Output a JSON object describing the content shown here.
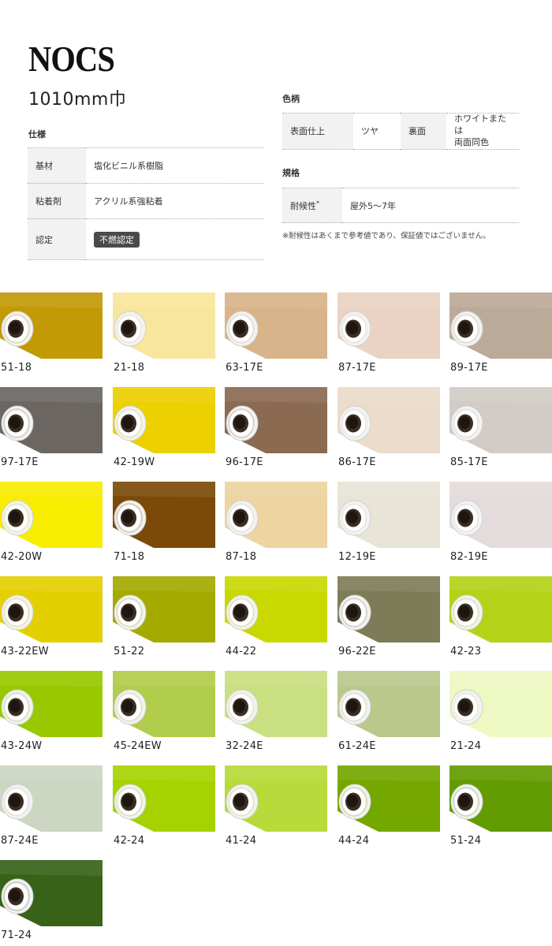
{
  "header": {
    "brand": "NOCS",
    "width": "1010mm巾"
  },
  "spec": {
    "title": "仕様",
    "rows": [
      {
        "key": "基材",
        "value": "塩化ビニル系樹脂"
      },
      {
        "key": "粘着剤",
        "value": "アクリル系強粘着"
      },
      {
        "key": "認定",
        "badge": "不燃認定"
      }
    ]
  },
  "pattern": {
    "title": "色柄",
    "surface_key": "表面仕上",
    "surface_value": "ツヤ",
    "back_key": "裏面",
    "back_value_line1": "ホワイトまたは",
    "back_value_line2": "両面同色"
  },
  "standard": {
    "title": "規格",
    "key": "耐候性",
    "key_mark": "*",
    "value": "屋外5～7年",
    "note": "※耐候性はあくまで参考値であり、保証値ではございません。"
  },
  "swatches": [
    {
      "code": "51-18",
      "color": "#c29a06"
    },
    {
      "code": "21-18",
      "color": "#f8e69c"
    },
    {
      "code": "63-17E",
      "color": "#d8b48a"
    },
    {
      "code": "87-17E",
      "color": "#ead3c2"
    },
    {
      "code": "89-17E",
      "color": "#bcaa98"
    },
    {
      "code": "97-17E",
      "color": "#6b6661"
    },
    {
      "code": "42-19W",
      "color": "#ecd000"
    },
    {
      "code": "96-17E",
      "color": "#8b6a52"
    },
    {
      "code": "86-17E",
      "color": "#ebdccb"
    },
    {
      "code": "85-17E",
      "color": "#d2cbc6"
    },
    {
      "code": "42-20W",
      "color": "#f8ec00"
    },
    {
      "code": "71-18",
      "color": "#7b4a08"
    },
    {
      "code": "87-18",
      "color": "#edd4a0"
    },
    {
      "code": "12-19E",
      "color": "#e8e4d6"
    },
    {
      "code": "82-19E",
      "color": "#e4dcdc"
    },
    {
      "code": "43-22EW",
      "color": "#e4d000"
    },
    {
      "code": "51-22",
      "color": "#a4aa00"
    },
    {
      "code": "44-22",
      "color": "#c8d800"
    },
    {
      "code": "96-22E",
      "color": "#7e7c58"
    },
    {
      "code": "42-23",
      "color": "#b4d218"
    },
    {
      "code": "43-24W",
      "color": "#98c800"
    },
    {
      "code": "45-24EW",
      "color": "#b2cc4c"
    },
    {
      "code": "32-24E",
      "color": "#cadf80"
    },
    {
      "code": "61-24E",
      "color": "#bac88c"
    },
    {
      "code": "21-24",
      "color": "#eef8c2"
    },
    {
      "code": "87-24E",
      "color": "#ccd6c0"
    },
    {
      "code": "42-24",
      "color": "#a6d300"
    },
    {
      "code": "41-24",
      "color": "#b8da3a"
    },
    {
      "code": "44-24",
      "color": "#74a800"
    },
    {
      "code": "51-24",
      "color": "#629c00"
    },
    {
      "code": "71-24",
      "color": "#386218"
    }
  ]
}
